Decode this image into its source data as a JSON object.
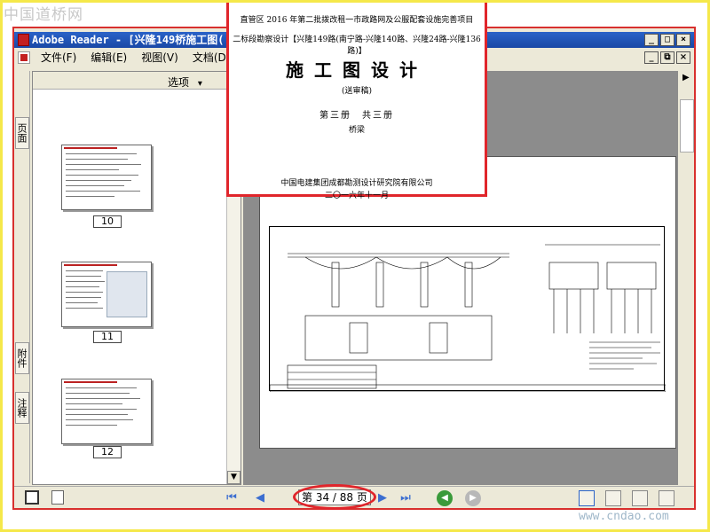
{
  "watermarks": {
    "top": "中国道桥网",
    "bottom": "www.cndao.com"
  },
  "window": {
    "title": "Adobe Reader - [兴隆149桥施工图(",
    "min": "_",
    "max": "□",
    "close": "×",
    "restore": "⧉"
  },
  "menu": {
    "items": [
      "文件(F)",
      "编辑(E)",
      "视图(V)",
      "文档(D)"
    ]
  },
  "side_tabs": {
    "pages": "页面",
    "attachments": "附件",
    "comments": "注释"
  },
  "pages_panel": {
    "options_label": "选项",
    "options_arrow": "▾",
    "thumbnails": [
      {
        "label": "10"
      },
      {
        "label": "11"
      },
      {
        "label": "12"
      }
    ]
  },
  "popup": {
    "line1": "直管区 2016 年第二批拨改租一市政路网及公服配套设施完善项目",
    "line2": "二标段勘察设计【兴隆149路(南宁路-兴隆140路、兴隆24路-兴隆136路)】",
    "title": "施工图设计",
    "subtitle": "(送审稿)",
    "volume": "第三册　共三册",
    "part": "桥梁",
    "org": "中国电建集团成都勘测设计研究院有限公司",
    "date": "二〇一六年十一月"
  },
  "statusbar": {
    "page_indicator": "第 34 / 88 页",
    "current_page": 34,
    "total_pages": 88
  },
  "icons": {
    "first": "⏮",
    "prev": "◀",
    "next": "▶",
    "last": "⏭",
    "back": "◀",
    "forward": "▶",
    "scroll_up": "▲",
    "scroll_down": "▼",
    "right_arrow": "▶"
  },
  "colors": {
    "highlight": "#e0252b",
    "titlebar": "#2a63c8",
    "frame": "#d8302e"
  }
}
